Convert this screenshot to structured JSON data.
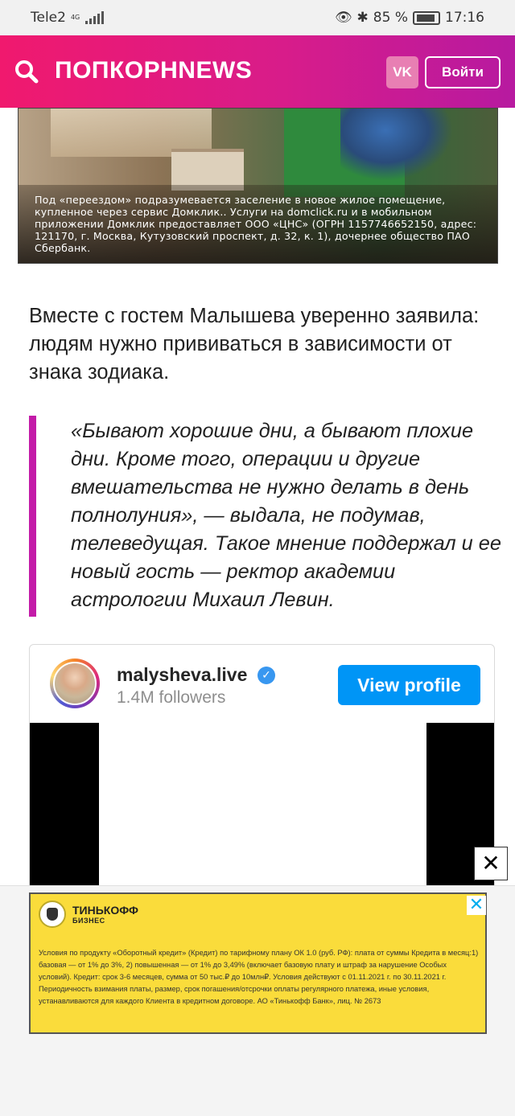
{
  "status_bar": {
    "carrier": "Tele2",
    "network": "4G",
    "battery": "85 %",
    "time": "17:16"
  },
  "header": {
    "logo": "ПОПКОРНNEWS",
    "vk_label": "VK",
    "login_label": "Войти"
  },
  "ad_banner": {
    "disclaimer": "Под «переездом» подразумевается заселение в новое жилое помещение, купленное через сервис Домклик.. Услуги на domclick.ru и в мобильном приложении Домклик предоставляет ООО «ЦНС» (ОГРН 1157746652150, адрес: 121170, г. Москва, Кутузовский проспект, д. 32, к. 1), дочернее общество ПАО Сбербанк."
  },
  "article": {
    "paragraph": "Вместе с гостем Малышева уверенно заявила: людям нужно прививаться в зависимости от знака зодиака.",
    "quote": "«Бывают хорошие дни, а бывают плохие дни. Кроме того, операции и другие вмешательства не нужно делать в день полнолуния», — выдала, не подумав, телеведущая. Такое мнение поддержал и ее новый гость — ректор академии астрологии Михаил Левин."
  },
  "instagram": {
    "username": "malysheva.live",
    "followers": "1.4M followers",
    "view_profile_label": "View profile"
  },
  "close_label": "✕",
  "tinkoff_ad": {
    "brand": "ТИНЬКОФФ",
    "sub": "БИЗНЕС",
    "text": "Условия по продукту «Оборотный кредит» (Кредит) по тарифному плану ОК 1.0 (руб. РФ): плата от суммы Кредита в месяц:1) базовая — от 1% до 3%, 2) повышенная — от 1% до 3,49% (включает базовую плату и штраф за нарушение Особых условий). Кредит: срок 3-6 месяцев, сумма от 50 тыс.₽ до 10млн₽. Условия действуют с 01.11.2021 г. по 30.11.2021 г. Периодичность взимания платы, размер, срок погашения/отсрочки оплаты регулярного платежа, иные условия, устанавливаются для каждого Клиента в кредитном договоре. АО «Тинькофф Банк», лиц. №  2673",
    "close_label": "✕"
  }
}
